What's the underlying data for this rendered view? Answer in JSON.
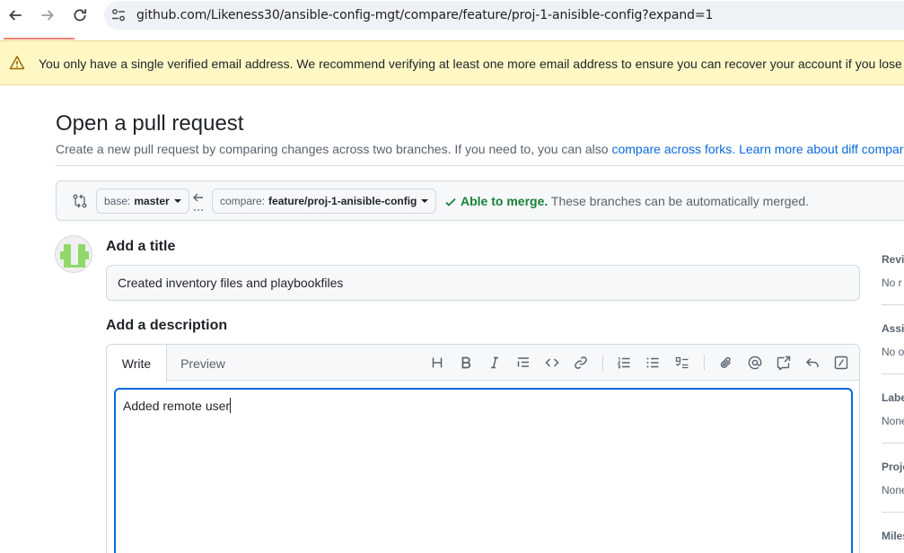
{
  "browser": {
    "url": "github.com/Likeness30/ansible-config-mgt/compare/feature/proj-1-anisible-config?expand=1"
  },
  "flash": {
    "message": "You only have a single verified email address. We recommend verifying at least one more email address to ensure you can recover your account if you lose ac"
  },
  "header": {
    "title": "Open a pull request",
    "subtitle_prefix": "Create a new pull request by comparing changes across two branches. If you need to, you can also ",
    "compare_forks_link": "compare across forks.",
    "learn_more_link": "Learn more about diff comparis"
  },
  "compare": {
    "base_prefix": "base:",
    "base_branch": "master",
    "compare_prefix": "compare:",
    "compare_branch": "feature/proj-1-anisible-config",
    "merge_ok": "Able to merge.",
    "merge_detail": " These branches can be automatically merged."
  },
  "form": {
    "title_label": "Add a title",
    "title_value": "Created inventory files and playbookfiles",
    "description_label": "Add a description",
    "tabs": [
      "Write",
      "Preview"
    ],
    "description_value": "Added remote user"
  },
  "sidebar": {
    "reviewers_label": "Revie",
    "reviewers_value": "No r",
    "assignees_label": "Assig",
    "assignees_value": "No o",
    "labels_label": "Labe",
    "labels_value": "None",
    "projects_label": "Proje",
    "projects_value": "None",
    "milestone_label": "Miles"
  },
  "colors": {
    "accent": "#0969da",
    "success": "#1a7f37",
    "flash_bg": "#fff8c5"
  }
}
